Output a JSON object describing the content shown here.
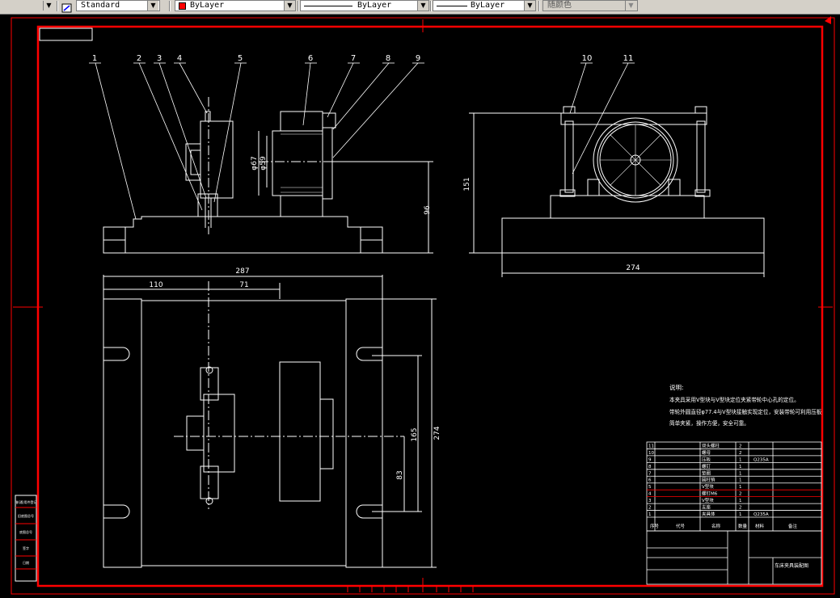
{
  "toolbar": {
    "text_style": "Standard",
    "layer_color": "ByLayer",
    "linetype": "ByLayer",
    "lineweight": "ByLayer",
    "plot_style": "随颜色",
    "colors": {
      "toolbar_bg": "#d4d0c8",
      "layer_swatch": "#ff0000"
    }
  },
  "drawing": {
    "colors": {
      "background": "#000000",
      "geometry": "#ffffff",
      "frame": "#ff0000",
      "dimension": "#ffffff"
    },
    "balloons": [
      "1",
      "2",
      "3",
      "4",
      "5",
      "6",
      "7",
      "8",
      "9",
      "10",
      "11"
    ],
    "front_view_dims": {
      "dia_outer": "φ67",
      "dia_inner": "φ59",
      "height": "96"
    },
    "side_view_dims": {
      "height": "151",
      "width": "274"
    },
    "top_view_dims": {
      "total_width": "287",
      "left_offset": "110",
      "center_offset": "71",
      "depth": "274",
      "slot_span": "165",
      "offset_83": "83"
    },
    "notes": {
      "heading": "说明:",
      "line1": "本夹具采用V型块与V型块定位夹紧带轮中心孔的定位。",
      "line2": "带轮外圆直径φ77.4与V型块接触实现定位，安装带轮可利用压板",
      "line3": "简单夹紧，操作方便，安全可靠。"
    },
    "bom": {
      "rows": [
        {
          "no": "11",
          "name": "双头螺柱",
          "qty": "2",
          "material": ""
        },
        {
          "no": "10",
          "name": "螺母",
          "qty": "2",
          "material": ""
        },
        {
          "no": "9",
          "name": "压板",
          "qty": "1",
          "material": "Q235A"
        },
        {
          "no": "8",
          "name": "螺钉",
          "qty": "1",
          "material": ""
        },
        {
          "no": "7",
          "name": "垫圈",
          "qty": "1",
          "material": ""
        },
        {
          "no": "6",
          "name": "圆柱销",
          "qty": "1",
          "material": ""
        },
        {
          "no": "5",
          "name": "V型块",
          "qty": "1",
          "material": ""
        },
        {
          "no": "4",
          "name": "螺钉M6",
          "qty": "2",
          "material": ""
        },
        {
          "no": "3",
          "name": "V型块",
          "qty": "1",
          "material": ""
        },
        {
          "no": "2",
          "name": "支座",
          "qty": "2",
          "material": ""
        },
        {
          "no": "1",
          "name": "夹具体",
          "qty": "1",
          "material": "Q235A"
        }
      ],
      "header": {
        "no": "序号",
        "code": "代号",
        "name": "名称",
        "qty": "数量",
        "material": "材料",
        "note": "备注"
      },
      "title": "车床夹具装配图"
    },
    "left_strip": [
      "借(通)用件登记",
      "旧底图总号",
      "底图总号",
      "签字",
      "日期"
    ]
  }
}
